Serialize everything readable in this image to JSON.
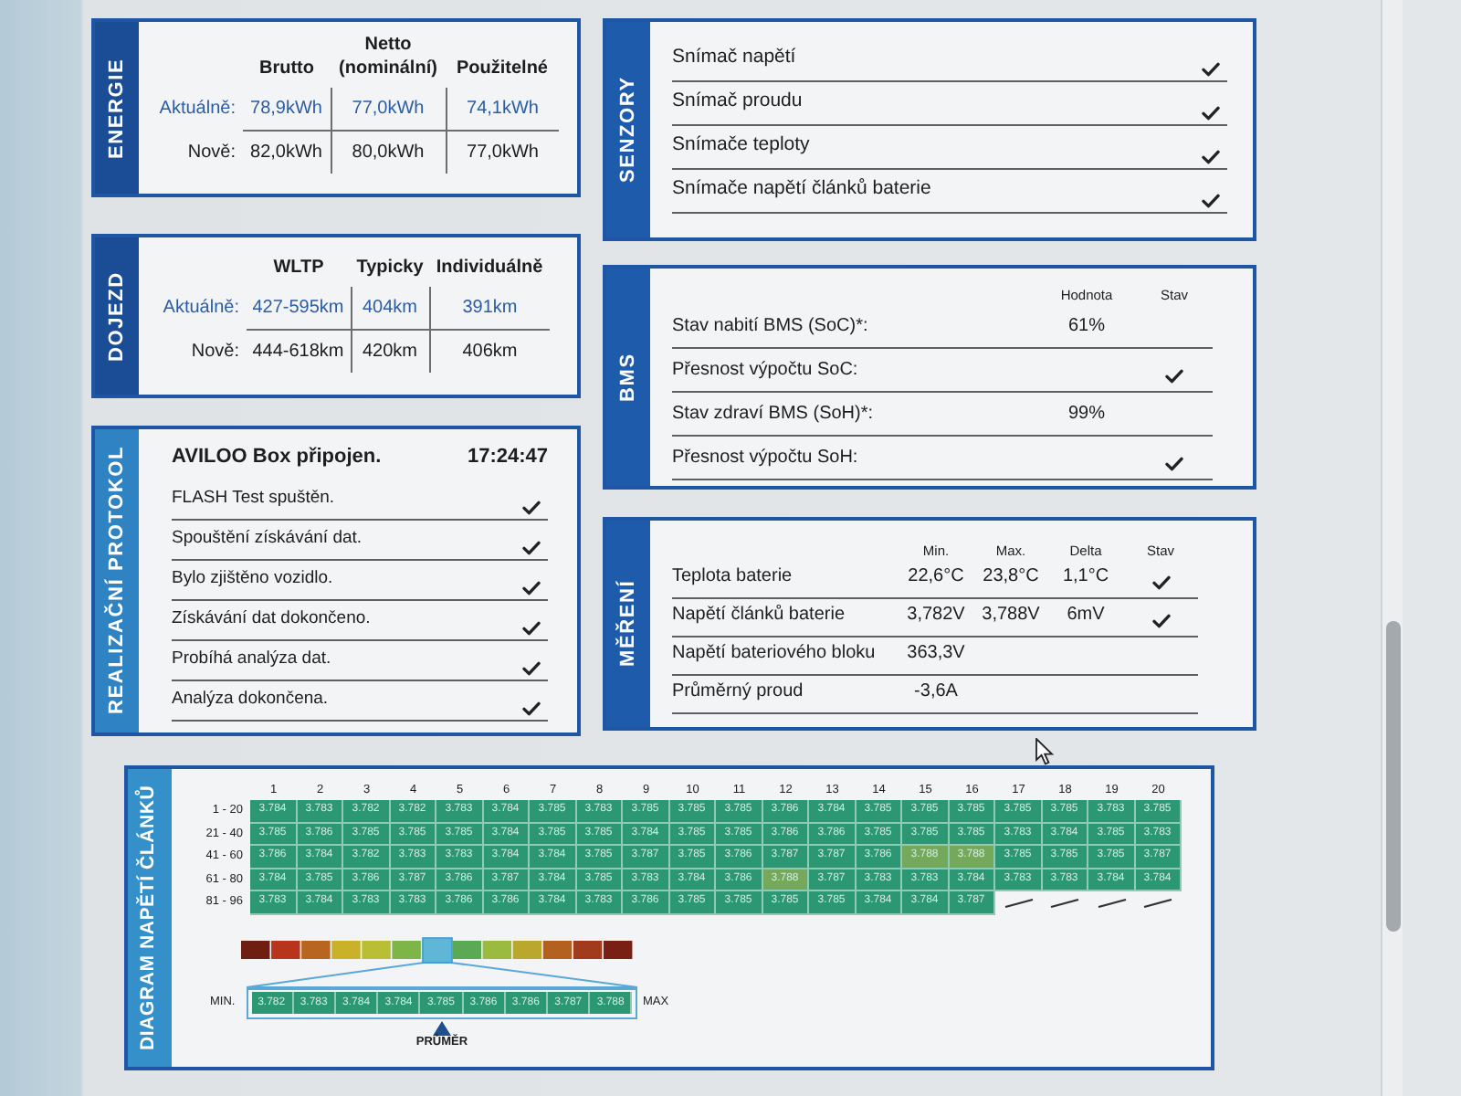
{
  "energie": {
    "title": "ENERGIE",
    "columns": [
      "Brutto",
      "Netto\n(nominální)",
      "Použitelné"
    ],
    "rows": [
      {
        "kind": "current",
        "label": "Aktuálně:",
        "values": [
          "78,9kWh",
          "77,0kWh",
          "74,1kWh"
        ]
      },
      {
        "kind": "new",
        "label": "Nově:",
        "values": [
          "82,0kWh",
          "80,0kWh",
          "77,0kWh"
        ]
      }
    ]
  },
  "dojezd": {
    "title": "DOJEZD",
    "columns": [
      "WLTP",
      "Typicky",
      "Individuálně"
    ],
    "rows": [
      {
        "kind": "current",
        "label": "Aktuálně:",
        "values": [
          "427-595km",
          "404km",
          "391km"
        ]
      },
      {
        "kind": "new",
        "label": "Nově:",
        "values": [
          "444-618km",
          "420km",
          "406km"
        ]
      }
    ]
  },
  "protokol": {
    "title": "REALIZAČNÍ PROTOKOL",
    "header": "AVILOO Box připojen.",
    "time": "17:24:47",
    "steps": [
      {
        "text": "FLASH Test spuštěn.",
        "checked": true
      },
      {
        "text": "Spouštění získávání dat.",
        "checked": true
      },
      {
        "text": "Bylo zjištěno vozidlo.",
        "checked": true
      },
      {
        "text": "Získávání dat dokončeno.",
        "checked": true
      },
      {
        "text": "Probíhá analýza dat.",
        "checked": true
      },
      {
        "text": "Analýza dokončena.",
        "checked": true
      }
    ]
  },
  "senzory": {
    "title": "SENZORY",
    "items": [
      {
        "label": "Snímač napětí",
        "checked": true
      },
      {
        "label": "Snímač proudu",
        "checked": true
      },
      {
        "label": "Snímače teploty",
        "checked": true
      },
      {
        "label": "Snímače napětí článků baterie",
        "checked": true
      }
    ]
  },
  "bms": {
    "title": "BMS",
    "columns": [
      "Hodnota",
      "Stav"
    ],
    "rows": [
      {
        "label": "Stav nabití BMS (SoC)*:",
        "value": "61%",
        "checked": false
      },
      {
        "label": "Přesnost výpočtu SoC:",
        "checked": true
      },
      {
        "label": "Stav zdraví BMS (SoH)*:",
        "value": "99%",
        "checked": false
      },
      {
        "label": "Přesnost výpočtu SoH:",
        "checked": true
      }
    ]
  },
  "mereni": {
    "title": "MĚŘENÍ",
    "columns": [
      "Min.",
      "Max.",
      "Delta",
      "Stav"
    ],
    "rows": [
      {
        "label": "Teplota baterie",
        "values": [
          "22,6°C",
          "23,8°C",
          "1,1°C"
        ],
        "checked": true
      },
      {
        "label": "Napětí článků baterie",
        "values": [
          "3,782V",
          "3,788V",
          "6mV"
        ],
        "checked": true
      },
      {
        "label": "Napětí bateriového bloku",
        "values": [
          "363,3V"
        ],
        "checked": false
      },
      {
        "label": "Průměrný proud",
        "values": [
          "-3,6A"
        ],
        "checked": false
      }
    ]
  },
  "diagram": {
    "title": "DIAGRAM NAPĚTÍ ČLÁNKŮ",
    "columns": [
      "1",
      "2",
      "3",
      "4",
      "5",
      "6",
      "7",
      "8",
      "9",
      "10",
      "11",
      "12",
      "13",
      "14",
      "15",
      "16",
      "17",
      "18",
      "19",
      "20"
    ],
    "rows": [
      {
        "label": "1 - 20",
        "cells": [
          "3.784",
          "3.783",
          "3.782",
          "3.782",
          "3.783",
          "3.784",
          "3.785",
          "3.783",
          "3.785",
          "3.785",
          "3.785",
          "3.786",
          "3.784",
          "3.785",
          "3.785",
          "3.785",
          "3.785",
          "3.785",
          "3.783",
          "3.785"
        ]
      },
      {
        "label": "21 - 40",
        "cells": [
          "3.785",
          "3.786",
          "3.785",
          "3.785",
          "3.785",
          "3.784",
          "3.785",
          "3.785",
          "3.784",
          "3.785",
          "3.785",
          "3.786",
          "3.786",
          "3.785",
          "3.785",
          "3.785",
          "3.783",
          "3.784",
          "3.785",
          "3.783"
        ]
      },
      {
        "label": "41 - 60",
        "cells": [
          "3.786",
          "3.784",
          "3.782",
          "3.783",
          "3.783",
          "3.784",
          "3.784",
          "3.785",
          "3.787",
          "3.785",
          "3.786",
          "3.787",
          "3.787",
          "3.786",
          "3.788",
          "3.788",
          "3.785",
          "3.785",
          "3.785",
          "3.787"
        ]
      },
      {
        "label": "61 - 80",
        "cells": [
          "3.784",
          "3.785",
          "3.786",
          "3.787",
          "3.786",
          "3.787",
          "3.784",
          "3.785",
          "3.783",
          "3.784",
          "3.786",
          "3.788",
          "3.787",
          "3.783",
          "3.783",
          "3.784",
          "3.783",
          "3.783",
          "3.784",
          "3.784"
        ]
      },
      {
        "label": "81 - 96",
        "cells": [
          "3.783",
          "3.784",
          "3.783",
          "3.783",
          "3.786",
          "3.786",
          "3.784",
          "3.783",
          "3.786",
          "3.785",
          "3.785",
          "3.785",
          "3.785",
          "3.784",
          "3.784",
          "3.787",
          null,
          null,
          null,
          null
        ]
      }
    ],
    "scale": {
      "min_label": "MIN.",
      "max_label": "MAX",
      "cells": [
        "3.782",
        "3.783",
        "3.784",
        "3.784",
        "3.785",
        "3.786",
        "3.786",
        "3.787",
        "3.788"
      ],
      "average_label": "PRŮMĚR"
    }
  }
}
